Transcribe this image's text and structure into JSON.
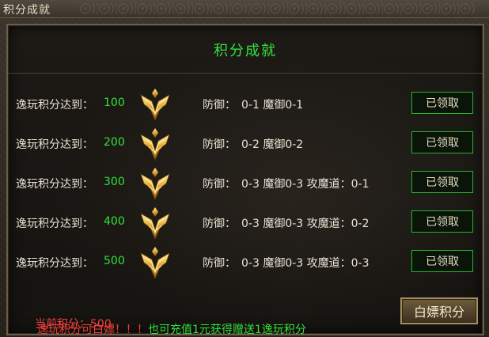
{
  "window": {
    "title": "积分成就"
  },
  "panel": {
    "title": "积分成就"
  },
  "rows": [
    {
      "label": "逸玩积分达到：",
      "score": "100",
      "reward_label": "防御：",
      "reward": "0-1 魔御0-1",
      "button": "已领取"
    },
    {
      "label": "逸玩积分达到：",
      "score": "200",
      "reward_label": "防御：",
      "reward": "0-2 魔御0-2",
      "button": "已领取"
    },
    {
      "label": "逸玩积分达到：",
      "score": "300",
      "reward_label": "防御：",
      "reward": "0-3 魔御0-3 攻魔道：0-1",
      "button": "已领取"
    },
    {
      "label": "逸玩积分达到：",
      "score": "400",
      "reward_label": "防御：",
      "reward": "0-3 魔御0-3 攻魔道：0-2",
      "button": "已领取"
    },
    {
      "label": "逸玩积分达到：",
      "score": "500",
      "reward_label": "防御：",
      "reward": "0-3 魔御0-3 攻魔道：0-3",
      "button": "已领取"
    }
  ],
  "footer": {
    "notice_red": "逸玩积分可白嫖！！！",
    "notice_green": "也可充值1元获得赠送1逸玩积分",
    "current_label": "当前积分：",
    "current_value": "500",
    "buy_button": "白嫖积分"
  },
  "colors": {
    "accent_green": "#33e13a",
    "alert_red": "#f0403a",
    "border_gold": "#a48e5c"
  },
  "icons": {
    "row_icon": "gold-winged-medal-icon"
  }
}
